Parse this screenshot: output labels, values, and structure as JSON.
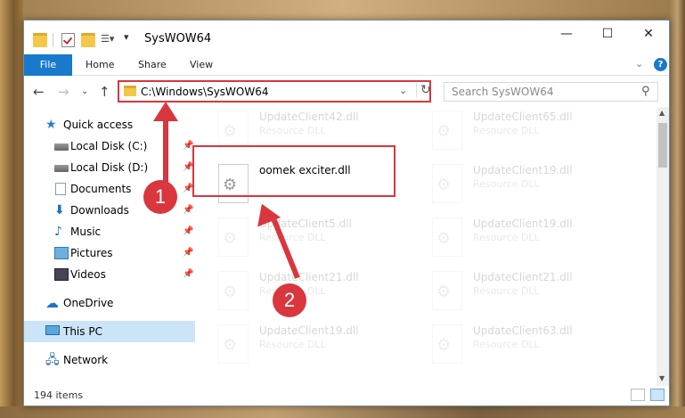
{
  "window": {
    "title": "SysWOW64",
    "controls": {
      "minimize": "—",
      "maximize": "☐",
      "close": "✕"
    }
  },
  "ribbon": {
    "tabs": [
      {
        "label": "File"
      },
      {
        "label": "Home"
      },
      {
        "label": "Share"
      },
      {
        "label": "View"
      }
    ]
  },
  "navigation": {
    "address": "C:\\Windows\\SysWOW64",
    "search_placeholder": "Search SysWOW64"
  },
  "sidebar": {
    "items": [
      {
        "label": "Quick access",
        "icon": "star-icon"
      },
      {
        "label": "Local Disk (C:)",
        "icon": "disk-icon",
        "pinned": true
      },
      {
        "label": "Local Disk (D:)",
        "icon": "disk-icon",
        "pinned": true
      },
      {
        "label": "Documents",
        "icon": "documents-icon",
        "pinned": true
      },
      {
        "label": "Downloads",
        "icon": "download-icon",
        "pinned": true
      },
      {
        "label": "Music",
        "icon": "music-icon",
        "pinned": true
      },
      {
        "label": "Pictures",
        "icon": "pictures-icon",
        "pinned": true
      },
      {
        "label": "Videos",
        "icon": "videos-icon",
        "pinned": true
      },
      {
        "label": "OneDrive",
        "icon": "cloud-icon"
      },
      {
        "label": "This PC",
        "icon": "pc-icon",
        "selected": true
      },
      {
        "label": "Network",
        "icon": "network-icon"
      }
    ]
  },
  "files": {
    "left": [
      {
        "name": "UpdateClient42.dll",
        "type": "Resource DLL"
      },
      {
        "name": "oomek exciter.dll",
        "type": ""
      },
      {
        "name": "UpdateClient5.dll",
        "type": "Resource DLL"
      },
      {
        "name": "UpdateClient21.dll",
        "type": "Resource DLL"
      },
      {
        "name": "UpdateClient19.dll",
        "type": "Resource DLL"
      }
    ],
    "right": [
      {
        "name": "UpdateClient65.dll",
        "type": "Resource DLL"
      },
      {
        "name": "UpdateClient19.dll",
        "type": "Resource DLL"
      },
      {
        "name": "UpdateClient19.dll",
        "type": "Resource DLL"
      },
      {
        "name": "UpdateClient21.dll",
        "type": "Resource DLL"
      },
      {
        "name": "UpdateClient63.dll",
        "type": "Resource DLL"
      }
    ]
  },
  "status": {
    "item_count": "194 items"
  },
  "annotations": {
    "step1": "1",
    "step2": "2"
  },
  "colors": {
    "accent": "#1979ca",
    "annotation": "#d9363e",
    "selected": "#cce4f7"
  }
}
